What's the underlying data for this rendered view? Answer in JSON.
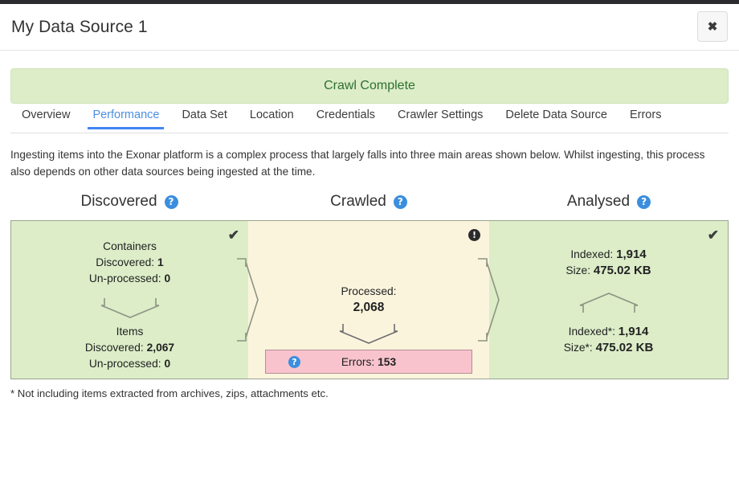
{
  "window": {
    "title": "My Data Source 1",
    "close_label": "✖"
  },
  "status": {
    "banner_text": "Crawl Complete",
    "banner_color": "#dcedc8",
    "banner_text_color": "#2f7031"
  },
  "tabs": [
    {
      "label": "Overview",
      "active": false
    },
    {
      "label": "Performance",
      "active": true
    },
    {
      "label": "Data Set",
      "active": false
    },
    {
      "label": "Location",
      "active": false
    },
    {
      "label": "Credentials",
      "active": false
    },
    {
      "label": "Crawler Settings",
      "active": false
    },
    {
      "label": "Delete Data Source",
      "active": false
    },
    {
      "label": "Errors",
      "active": false
    }
  ],
  "description": "Ingesting items into the Exonar platform is a complex process that largely falls into three main areas shown below. Whilst ingesting, this process also depends on other data sources being ingested at the time.",
  "headings": {
    "discovered": "Discovered",
    "crawled": "Crawled",
    "analysed": "Analysed",
    "help_glyph": "?"
  },
  "panels": {
    "discovered": {
      "status_glyph": "✔",
      "top": {
        "title": "Containers",
        "line1_label": "Discovered:",
        "line1_value": "1",
        "line2_label": "Un-processed:",
        "line2_value": "0"
      },
      "bottom": {
        "title": "Items",
        "line1_label": "Discovered:",
        "line1_value": "2,067",
        "line2_label": "Un-processed:",
        "line2_value": "0"
      }
    },
    "crawled": {
      "status_glyph": "!",
      "processed_label": "Processed:",
      "processed_value": "2,068",
      "errors_label": "Errors:",
      "errors_value": "153",
      "errors_help_glyph": "?"
    },
    "analysed": {
      "status_glyph": "✔",
      "top": {
        "line1_label": "Indexed:",
        "line1_value": "1,914",
        "line2_label": "Size:",
        "line2_value": "475.02 KB"
      },
      "bottom": {
        "line1_label": "Indexed*:",
        "line1_value": "1,914",
        "line2_label": "Size*:",
        "line2_value": "475.02 KB"
      }
    }
  },
  "footnote": "* Not including items extracted from archives, zips, attachments etc."
}
